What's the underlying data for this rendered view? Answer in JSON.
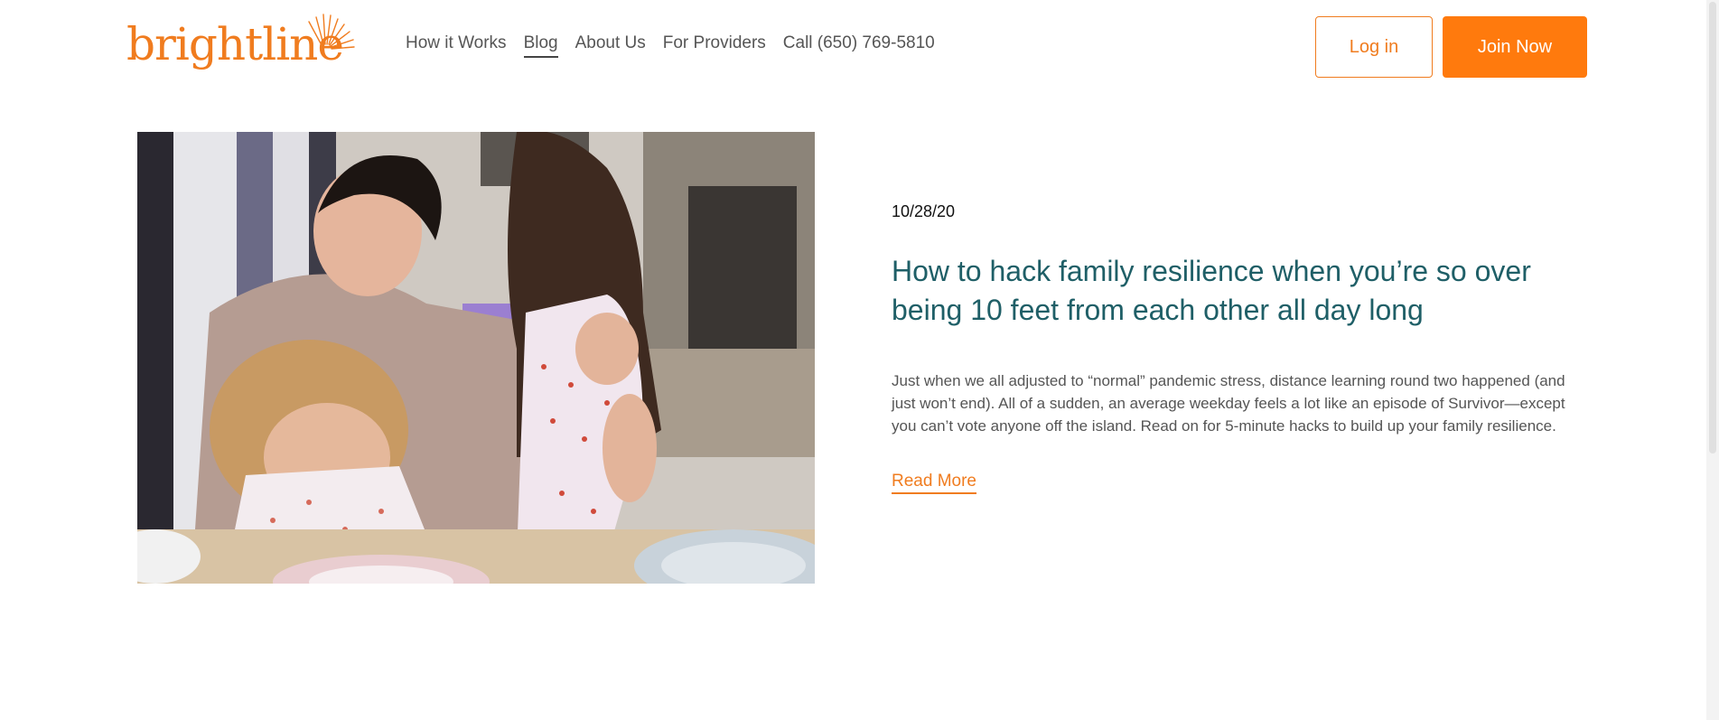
{
  "brand": {
    "logo_text": "brightline",
    "color": "#f07c1f"
  },
  "nav": {
    "items": [
      {
        "label": "How it Works",
        "active": false
      },
      {
        "label": "Blog",
        "active": true
      },
      {
        "label": "About Us",
        "active": false
      },
      {
        "label": "For Providers",
        "active": false
      },
      {
        "label": "Call (650) 769-5810",
        "active": false
      }
    ]
  },
  "header": {
    "login_label": "Log in",
    "join_label": "Join Now"
  },
  "hero": {
    "icon": "photo-father-and-two-daughters"
  },
  "article": {
    "date": "10/28/20",
    "title": "How to hack family resilience when you’re so over being 10 feet from each other all day long",
    "excerpt": "Just when we all adjusted to “normal” pandemic stress, distance learning round two happened (and just won’t end). All of a sudden, an average weekday feels a lot like an episode of Survivor—except you can’t vote anyone off the island. Read on for 5-minute hacks to build up your family resilience.",
    "read_more_label": "Read More"
  },
  "colors": {
    "accent": "#f07c1f",
    "button_fill": "#ff7a0d",
    "title": "#1f5f67",
    "body_text": "#555555"
  }
}
